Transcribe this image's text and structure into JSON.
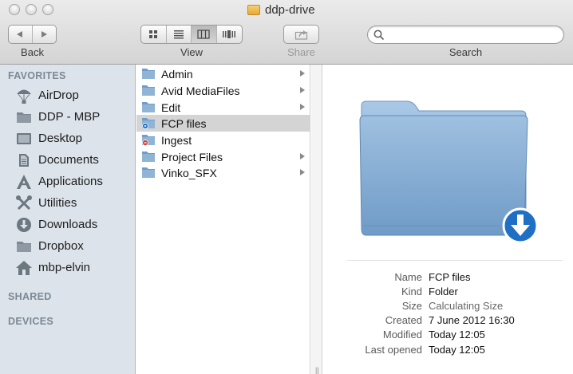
{
  "window": {
    "title": "ddp-drive"
  },
  "toolbar": {
    "back_label": "Back",
    "view_label": "View",
    "share_label": "Share",
    "search_label": "Search",
    "search_placeholder": "",
    "active_view": "column"
  },
  "sidebar": {
    "favorites_heading": "FAVORITES",
    "items": [
      {
        "label": "AirDrop",
        "icon": "airdrop-icon"
      },
      {
        "label": "DDP - MBP",
        "icon": "folder-icon"
      },
      {
        "label": "Desktop",
        "icon": "desktop-icon"
      },
      {
        "label": "Documents",
        "icon": "documents-icon"
      },
      {
        "label": "Applications",
        "icon": "applications-icon"
      },
      {
        "label": "Utilities",
        "icon": "utilities-icon"
      },
      {
        "label": "Downloads",
        "icon": "downloads-icon"
      },
      {
        "label": "Dropbox",
        "icon": "folder-icon"
      },
      {
        "label": "mbp-elvin",
        "icon": "home-icon"
      }
    ],
    "shared_heading": "SHARED",
    "devices_heading": "DEVICES"
  },
  "column": {
    "rows": [
      {
        "label": "Admin",
        "has_children": true,
        "selected": false
      },
      {
        "label": "Avid MediaFiles",
        "has_children": true,
        "selected": false
      },
      {
        "label": "Edit",
        "has_children": true,
        "selected": false
      },
      {
        "label": "FCP files",
        "has_children": false,
        "selected": true
      },
      {
        "label": "Ingest",
        "has_children": false,
        "selected": false
      },
      {
        "label": "Project Files",
        "has_children": true,
        "selected": false
      },
      {
        "label": "Vinko_SFX",
        "has_children": true,
        "selected": false
      }
    ]
  },
  "preview": {
    "info": [
      {
        "key": "Name",
        "value": "FCP files"
      },
      {
        "key": "Kind",
        "value": "Folder"
      },
      {
        "key": "Size",
        "value": "Calculating Size"
      },
      {
        "key": "Created",
        "value": "7 June 2012 16:30"
      },
      {
        "key": "Modified",
        "value": "Today 12:05"
      },
      {
        "key": "Last opened",
        "value": "Today 12:05"
      }
    ]
  },
  "colors": {
    "sidebar_bg": "#dde3ea",
    "selection_gray": "#d4d4d4",
    "folder_blue": "#8fb4d6",
    "download_badge": "#1f6fc4"
  }
}
